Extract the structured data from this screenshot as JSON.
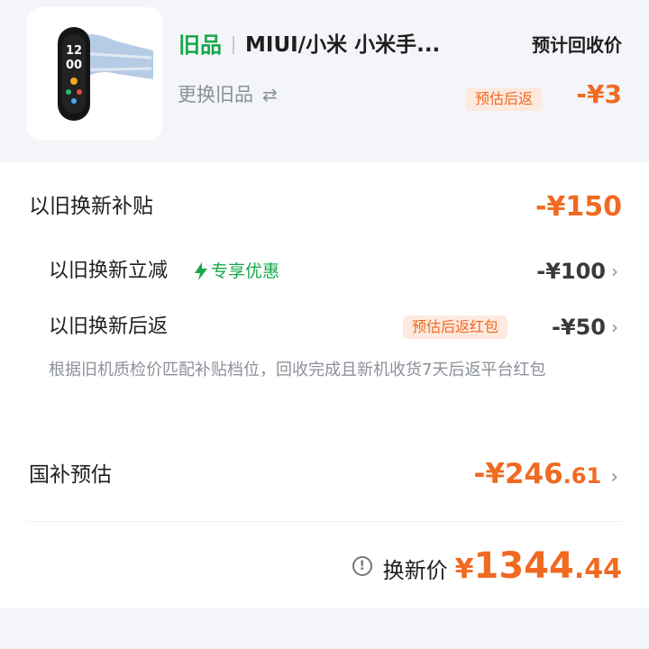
{
  "old_item": {
    "tag": "旧品",
    "name": "MIUI/小米 小米手...",
    "change_label": "更换旧品",
    "swap_icon": "swap-arrows-icon",
    "recycle_label": "预计回收价",
    "est_badge": "预估后返",
    "recycle_price": "-¥3"
  },
  "subsidy": {
    "title": "以旧换新补贴",
    "total": "-¥150",
    "instant": {
      "label": "以旧换新立减",
      "exclusive_label": "专享优惠",
      "amount": "-¥100"
    },
    "rebate": {
      "label": "以旧换新后返",
      "badge": "预估后返红包",
      "amount": "-¥50"
    },
    "note": "根据旧机质检价匹配补贴档位，回收完成且新机收货7天后返平台红包"
  },
  "national": {
    "label": "国补预估",
    "amount_int": "-¥246",
    "amount_dec": ".61"
  },
  "final": {
    "label": "换新价",
    "currency": "¥",
    "price_int": "1344",
    "price_dec": ".44"
  },
  "colors": {
    "accent_orange": "#f06a22",
    "accent_green": "#16a84a"
  }
}
